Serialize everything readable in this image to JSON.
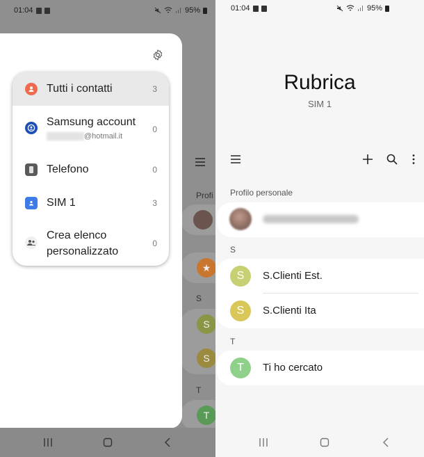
{
  "left": {
    "status": {
      "time": "01:04",
      "battery": "95%"
    },
    "drawer": {
      "items": [
        {
          "label": "Tutti i contatti",
          "count": "3",
          "selected": true
        },
        {
          "label": "Samsung account",
          "sublabel": "@hotmail.it",
          "count": "0"
        },
        {
          "label": "Telefono",
          "count": "0"
        },
        {
          "label": "SIM 1",
          "count": "3"
        },
        {
          "label_line1": "Crea elenco",
          "label_line2": "personalizzato",
          "count": "0"
        }
      ]
    },
    "background": {
      "profile_prefix": "Profi",
      "section_s": "S",
      "section_t": "T",
      "avatars": [
        "S",
        "S",
        "T"
      ]
    }
  },
  "right": {
    "status": {
      "time": "01:04",
      "battery": "95%"
    },
    "title": "Rubrica",
    "subtitle": "SIM 1",
    "profile_section": "Profilo personale",
    "sections": [
      {
        "letter": "S",
        "contacts": [
          {
            "initial": "S",
            "name": "S.Clienti Est."
          },
          {
            "initial": "S",
            "name": "S.Clienti Ita"
          }
        ]
      },
      {
        "letter": "T",
        "contacts": [
          {
            "initial": "T",
            "name": "Ti ho cercato"
          }
        ]
      }
    ]
  },
  "colors": {
    "accent_orange": "#ef6b4f",
    "avatar_s": "#d9c75a",
    "avatar_s1": "#c7d173",
    "avatar_t": "#8fd18a",
    "samsung_blue": "#1f4fb8",
    "sim_blue": "#3c7be8"
  }
}
